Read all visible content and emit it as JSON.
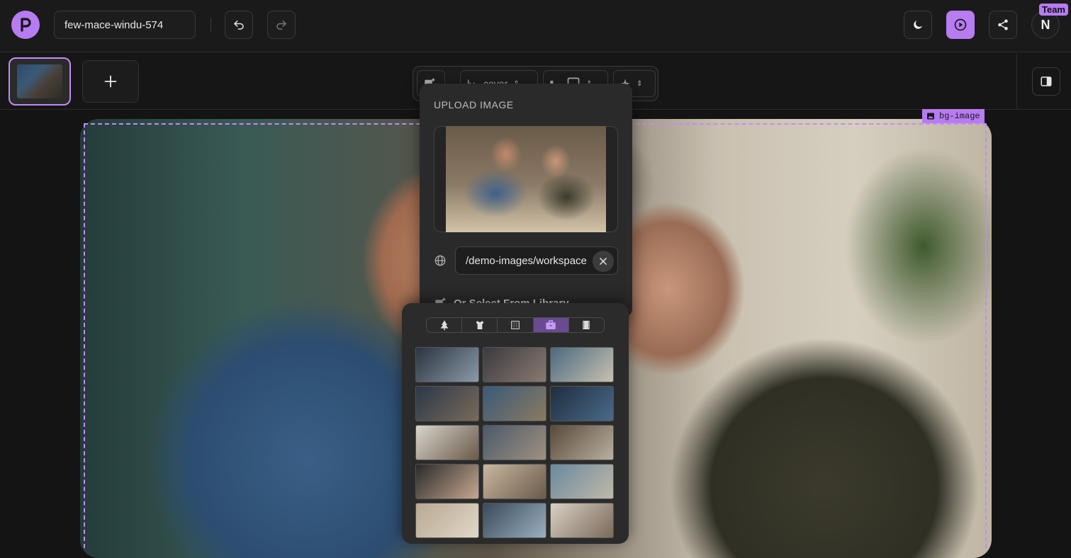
{
  "header": {
    "doc_name": "few-mace-windu-574",
    "team_badge": "Team",
    "avatar_initial": "N"
  },
  "toolbar": {
    "fit_label": "cover"
  },
  "canvas": {
    "element_tag": "bg-image"
  },
  "upload_popover": {
    "title": "UPLOAD IMAGE",
    "url_value": "/demo-images/workspace",
    "library_label": "Or Select From Library"
  },
  "library": {
    "active_tab": "briefcase-icon",
    "tabs": [
      "tree-icon",
      "shirt-icon",
      "texture-icon",
      "briefcase-icon",
      "film-icon"
    ],
    "thumbnails": [
      {
        "c1": "#2c3440",
        "c2": "#8a9aa8"
      },
      {
        "c1": "#3a3a40",
        "c2": "#8a7a70"
      },
      {
        "c1": "#4a6a80",
        "c2": "#c8c0b0"
      },
      {
        "c1": "#2a3848",
        "c2": "#7a6a5a"
      },
      {
        "c1": "#3a5a78",
        "c2": "#8a7a60"
      },
      {
        "c1": "#1f2e3e",
        "c2": "#4a6a8a"
      },
      {
        "c1": "#d8d4cc",
        "c2": "#6a5a4a"
      },
      {
        "c1": "#4a5a6a",
        "c2": "#a09080"
      },
      {
        "c1": "#5a4a3a",
        "c2": "#b8b0a0"
      },
      {
        "c1": "#2a2a2a",
        "c2": "#c8a890"
      },
      {
        "c1": "#c8b8a0",
        "c2": "#6a5a4a"
      },
      {
        "c1": "#6a8aa0",
        "c2": "#c0b8a8"
      },
      {
        "c1": "#b8a890",
        "c2": "#e0d8c8"
      },
      {
        "c1": "#3a4a5a",
        "c2": "#9ab0c0"
      },
      {
        "c1": "#d8d0c4",
        "c2": "#7a6a5a"
      }
    ]
  }
}
